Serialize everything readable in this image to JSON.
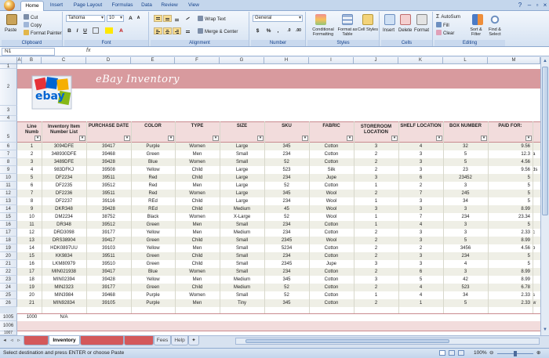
{
  "ribbon": {
    "tabs": [
      "Home",
      "Insert",
      "Page Layout",
      "Formulas",
      "Data",
      "Review",
      "View"
    ],
    "active_tab": "Home",
    "clipboard": {
      "paste": "Paste",
      "cut": "Cut",
      "copy": "Copy",
      "format_painter": "Format Painter",
      "label": "Clipboard"
    },
    "font": {
      "name": "Tahoma",
      "size": "10",
      "bold": "B",
      "italic": "I",
      "underline": "U",
      "label": "Font"
    },
    "alignment": {
      "wrap_text": "Wrap Text",
      "merge_center": "Merge & Center",
      "label": "Alignment"
    },
    "number": {
      "format": "General",
      "currency": "$",
      "percent": "%",
      "comma": ",",
      "label": "Number"
    },
    "styles": {
      "conditional": "Conditional Formatting",
      "format_table": "Format as Table",
      "cell_styles": "Cell Styles",
      "label": "Styles"
    },
    "cells": {
      "insert": "Insert",
      "delete": "Delete",
      "format": "Format",
      "label": "Cells"
    },
    "editing": {
      "autosum": "AutoSum",
      "fill": "Fill",
      "clear": "Clear",
      "sort_filter": "Sort & Filter",
      "find_select": "Find & Select",
      "label": "Editing"
    }
  },
  "formula_bar": {
    "name_box": "N1",
    "fx": "fx",
    "value": ""
  },
  "columns": [
    "A",
    "B",
    "C",
    "D",
    "E",
    "F",
    "G",
    "H",
    "I",
    "J",
    "K",
    "L",
    "M"
  ],
  "row_numbers_top": [
    "1",
    "2",
    "3",
    "4",
    "5"
  ],
  "row_numbers_bottom": [
    "1005",
    "1006",
    "1007"
  ],
  "sheet_title": "eBay Inventory",
  "logo_text": "ebay",
  "headers": {
    "line": "Line Numb",
    "item": "Inventory Item Number List",
    "date": "PURCHASE DATE",
    "color": "COLOR",
    "type": "TYPE",
    "size": "SIZE",
    "sku": "SKU",
    "fabric": "FABRIC",
    "storeroom": "STOREROOM LOCATION",
    "shelf": "SHELF LOCATION",
    "box": "BOX NUMBER",
    "paid": "PAID FOR:"
  },
  "rows": [
    {
      "n": "1",
      "item": "3094DFE",
      "date": "39417",
      "color": "Purple",
      "type": "Women",
      "size": "Large",
      "sku": "345",
      "fabric": "Cotton",
      "store": "3",
      "shelf": "4",
      "box": "32",
      "paid": "9.56",
      "extra": ""
    },
    {
      "n": "2",
      "item": "348930DFE",
      "date": "39468",
      "color": "Green",
      "type": "Men",
      "size": "Small",
      "sku": "234",
      "fabric": "Cotton",
      "store": "2",
      "shelf": "3",
      "box": "5",
      "paid": "12.3",
      "extra": "a"
    },
    {
      "n": "3",
      "item": "3489DFE",
      "date": "39428",
      "color": "Blue",
      "type": "Women",
      "size": "Small",
      "sku": "52",
      "fabric": "Cotton",
      "store": "2",
      "shelf": "3",
      "box": "5",
      "paid": "4.56",
      "extra": ""
    },
    {
      "n": "4",
      "item": "983DFKJ",
      "date": "39508",
      "color": "Yellow",
      "type": "Child",
      "size": "Large",
      "sku": "523",
      "fabric": "Silk",
      "store": "2",
      "shelf": "3",
      "box": "23",
      "paid": "9.56",
      "extra": "ds"
    },
    {
      "n": "5",
      "item": "DF2234",
      "date": "39511",
      "color": "Red",
      "type": "Child",
      "size": "Large",
      "sku": "234",
      "fabric": "Jupe",
      "store": "3",
      "shelf": "6",
      "box": "23452",
      "paid": "5",
      "extra": ""
    },
    {
      "n": "6",
      "item": "DF2235",
      "date": "39512",
      "color": "Red",
      "type": "Men",
      "size": "Large",
      "sku": "52",
      "fabric": "Cotton",
      "store": "1",
      "shelf": "2",
      "box": "3",
      "paid": "5",
      "extra": ""
    },
    {
      "n": "7",
      "item": "DF2236",
      "date": "39511",
      "color": "Red",
      "type": "Women",
      "size": "Large",
      "sku": "345",
      "fabric": "Wool",
      "store": "2",
      "shelf": "7",
      "box": "245",
      "paid": "5",
      "extra": ""
    },
    {
      "n": "8",
      "item": "DF2237",
      "date": "39116",
      "color": "REd",
      "type": "Child",
      "size": "Large",
      "sku": "234",
      "fabric": "Wool",
      "store": "1",
      "shelf": "3",
      "box": "34",
      "paid": "5",
      "extra": ""
    },
    {
      "n": "9",
      "item": "DKR348",
      "date": "39428",
      "color": "REd",
      "type": "Child",
      "size": "Medium",
      "sku": "45",
      "fabric": "Wool",
      "store": "3",
      "shelf": "3",
      "box": "3",
      "paid": "8.99",
      "extra": ""
    },
    {
      "n": "10",
      "item": "DM2234",
      "date": "38752",
      "color": "Black",
      "type": "Women",
      "size": "X-Large",
      "sku": "52",
      "fabric": "Wool",
      "store": "1",
      "shelf": "7",
      "box": "234",
      "paid": "23.34",
      "extra": ""
    },
    {
      "n": "11",
      "item": "DR348",
      "date": "39512",
      "color": "Green",
      "type": "Men",
      "size": "Small",
      "sku": "234",
      "fabric": "Cotton",
      "store": "1",
      "shelf": "4",
      "box": "3",
      "paid": "5",
      "extra": ""
    },
    {
      "n": "12",
      "item": "DRD3098",
      "date": "39177",
      "color": "Yellow",
      "type": "Men",
      "size": "Medium",
      "sku": "234",
      "fabric": "Cotton",
      "store": "2",
      "shelf": "3",
      "box": "3",
      "paid": "2.33",
      "extra": "c"
    },
    {
      "n": "13",
      "item": "DRS38904",
      "date": "39417",
      "color": "Green",
      "type": "Child",
      "size": "Small",
      "sku": "2345",
      "fabric": "Wool",
      "store": "2",
      "shelf": "3",
      "box": "5",
      "paid": "8.99",
      "extra": ""
    },
    {
      "n": "14",
      "item": "HDK0897UU",
      "date": "39103",
      "color": "Yellow",
      "type": "Men",
      "size": "Small",
      "sku": "5234",
      "fabric": "Cotton",
      "store": "2",
      "shelf": "2",
      "box": "3456",
      "paid": "4.56",
      "extra": "b"
    },
    {
      "n": "15",
      "item": "KK9834",
      "date": "39511",
      "color": "Green",
      "type": "Child",
      "size": "Small",
      "sku": "234",
      "fabric": "Cotton",
      "store": "2",
      "shelf": "3",
      "box": "234",
      "paid": "5",
      "extra": ""
    },
    {
      "n": "16",
      "item": "LKM80979",
      "date": "39510",
      "color": "Green",
      "type": "Child",
      "size": "Small",
      "sku": "2345",
      "fabric": "Jupe",
      "store": "3",
      "shelf": "3",
      "box": "4",
      "paid": "5",
      "extra": ""
    },
    {
      "n": "17",
      "item": "MIN021938",
      "date": "39417",
      "color": "Blue",
      "type": "Women",
      "size": "Small",
      "sku": "234",
      "fabric": "Cotton",
      "store": "2",
      "shelf": "6",
      "box": "3",
      "paid": "8.99",
      "extra": ""
    },
    {
      "n": "18",
      "item": "MIN02394",
      "date": "39428",
      "color": "Yellow",
      "type": "Men",
      "size": "Medium",
      "sku": "345",
      "fabric": "Cotton",
      "store": "3",
      "shelf": "5",
      "box": "42",
      "paid": "8.99",
      "extra": ""
    },
    {
      "n": "19",
      "item": "MIN2323",
      "date": "39177",
      "color": "Green",
      "type": "Child",
      "size": "Medium",
      "sku": "52",
      "fabric": "Cotton",
      "store": "2",
      "shelf": "4",
      "box": "523",
      "paid": "6.78",
      "extra": ""
    },
    {
      "n": "20",
      "item": "MIN3984",
      "date": "39468",
      "color": "Purple",
      "type": "Women",
      "size": "Small",
      "sku": "52",
      "fabric": "Cotton",
      "store": "1",
      "shelf": "4",
      "box": "34",
      "paid": "2.33",
      "extra": "s"
    },
    {
      "n": "21",
      "item": "MIN92834",
      "date": "39105",
      "color": "Purple",
      "type": "Men",
      "size": "Tiny",
      "sku": "345",
      "fabric": "Cotton",
      "store": "2",
      "shelf": "1",
      "box": "5",
      "paid": "2.33",
      "extra": "w"
    }
  ],
  "total_row": {
    "row_label": "1005",
    "line": "1000",
    "item": "N/A"
  },
  "sheet_tabs": [
    "Inventory",
    "Fees",
    "Help"
  ],
  "status": {
    "message": "Select destination and press ENTER or choose Paste",
    "zoom": "100%"
  },
  "colors": {
    "banner": "#d89a9e",
    "header_fill": "#f2dcdc",
    "band": "#efefe6",
    "ribbon": "#d5e2f2"
  }
}
